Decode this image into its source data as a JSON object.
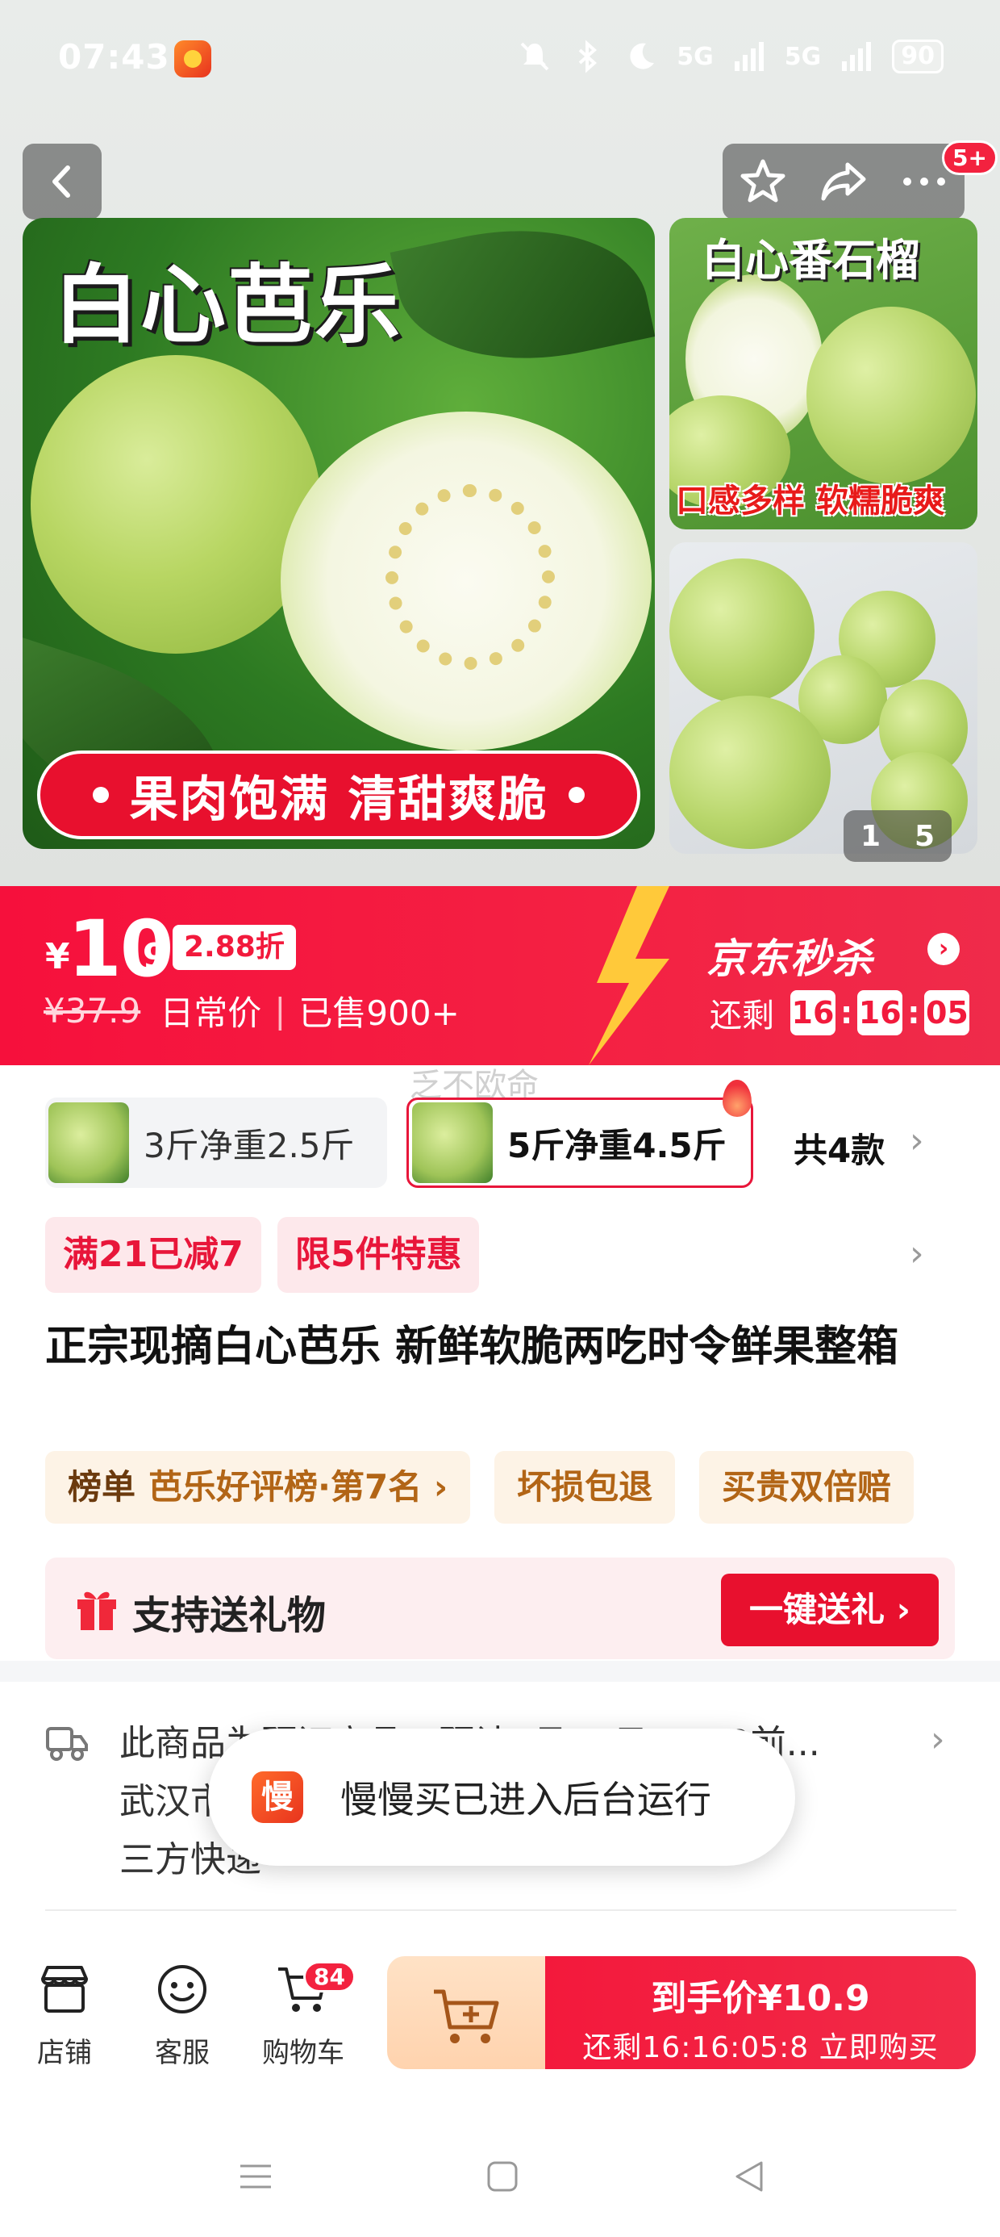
{
  "status_bar": {
    "time": "07:43",
    "network_1": "5G",
    "network_2": "5G",
    "battery": "90"
  },
  "header": {
    "cart_badge_count": "5+"
  },
  "gallery": {
    "main_title": "白心芭乐",
    "main_banner": "果肉饱满 清甜爽脆",
    "side1_title": "白心番石榴",
    "side1_sub": "口感多样 软糯脆爽",
    "counter_current": "1",
    "counter_total": "5"
  },
  "price": {
    "currency": "¥",
    "integer": "10",
    "decimal": ".9",
    "discount": "2.88折",
    "original": "¥37.9",
    "original_label": "日常价",
    "separator": "|",
    "sold": "已售900+",
    "seckill_title": "京东秒杀",
    "remaining_label": "还剩",
    "countdown": {
      "h": "16",
      "m": "16",
      "s": "05"
    }
  },
  "watermark": "乏不欧命",
  "specs": {
    "items": [
      {
        "label": "3斤净重2.5斤",
        "selected": false
      },
      {
        "label": "5斤净重4.5斤",
        "selected": true
      }
    ],
    "total": "共4款"
  },
  "promos": [
    "满21已减7",
    "限5件特惠"
  ],
  "product_title": "正宗现摘白心芭乐 新鲜软脆两吃时令鲜果整箱",
  "tags": {
    "ranking_prefix": "榜单",
    "ranking_text": "芭乐好评榜·第7名",
    "damage": "坏损包退",
    "overpay": "买贵双倍赔"
  },
  "gift": {
    "label": "支持送礼物",
    "button": "一键送礼"
  },
  "shipping": {
    "line1": "此商品为预订商品，预计2月27日24:00前...",
    "line2": "武汉市",
    "line3": "三方快递"
  },
  "toast": {
    "logo_char": "慢",
    "text": "慢慢买已进入后台运行"
  },
  "bottom_bar": {
    "store": "店铺",
    "service": "客服",
    "cart": "购物车",
    "cart_count": "84",
    "buy_line1": "到手价¥10.9",
    "buy_line2": "还剩16:16:05:8  立即购买"
  },
  "colors": {
    "brand_red": "#f3193c",
    "orange_tag": "#b26516",
    "promo_bg": "#fde8eb"
  }
}
